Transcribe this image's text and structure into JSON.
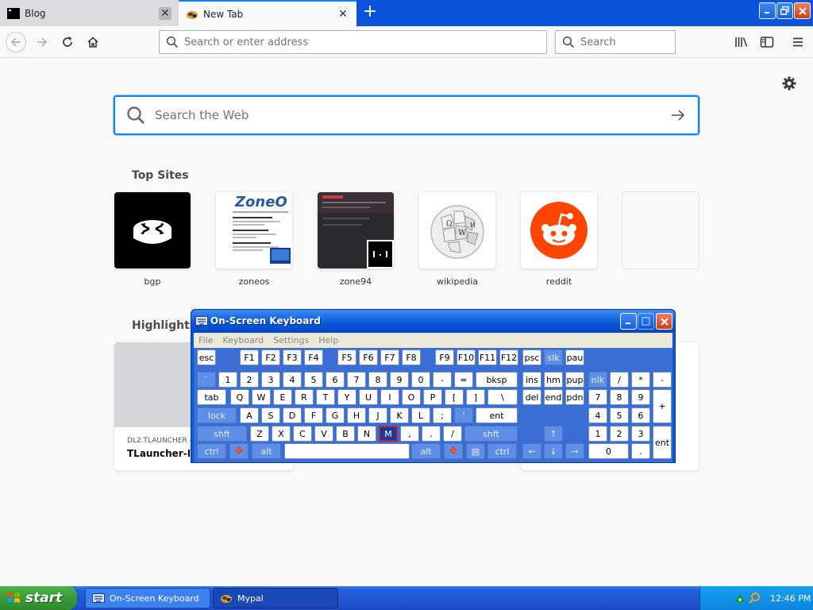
{
  "browser": {
    "tabs": [
      {
        "label": "Blog",
        "active": false
      },
      {
        "label": "New Tab",
        "active": true
      }
    ],
    "address_placeholder": "Search or enter address",
    "search_placeholder": "Search"
  },
  "newtab": {
    "web_search_placeholder": "Search the Web",
    "top_sites_title": "Top Sites",
    "top_sites": [
      {
        "name": "bgp"
      },
      {
        "name": "zoneos"
      },
      {
        "name": "zone94"
      },
      {
        "name": "wikipedia"
      },
      {
        "name": "reddit"
      }
    ],
    "highlights_title": "Highlights",
    "highlight_card": {
      "source": "DL2.TLAUNCHER –",
      "title": "TLauncher-Ins"
    }
  },
  "osk": {
    "title": "On-Screen Keyboard",
    "menu": [
      "File",
      "Keyboard",
      "Settings",
      "Help"
    ],
    "selected_key": "M"
  },
  "taskbar": {
    "start_label": "start",
    "buttons": [
      {
        "label": "On-Screen Keyboard"
      },
      {
        "label": "Mypal"
      }
    ],
    "clock": "12:46 PM"
  },
  "colors": {
    "accent": "#0a84ff",
    "tab_strip": "#0a54dc",
    "reddit": "#ff4500",
    "xp_taskbar": "#245edb",
    "xp_start": "#3a9a38"
  }
}
